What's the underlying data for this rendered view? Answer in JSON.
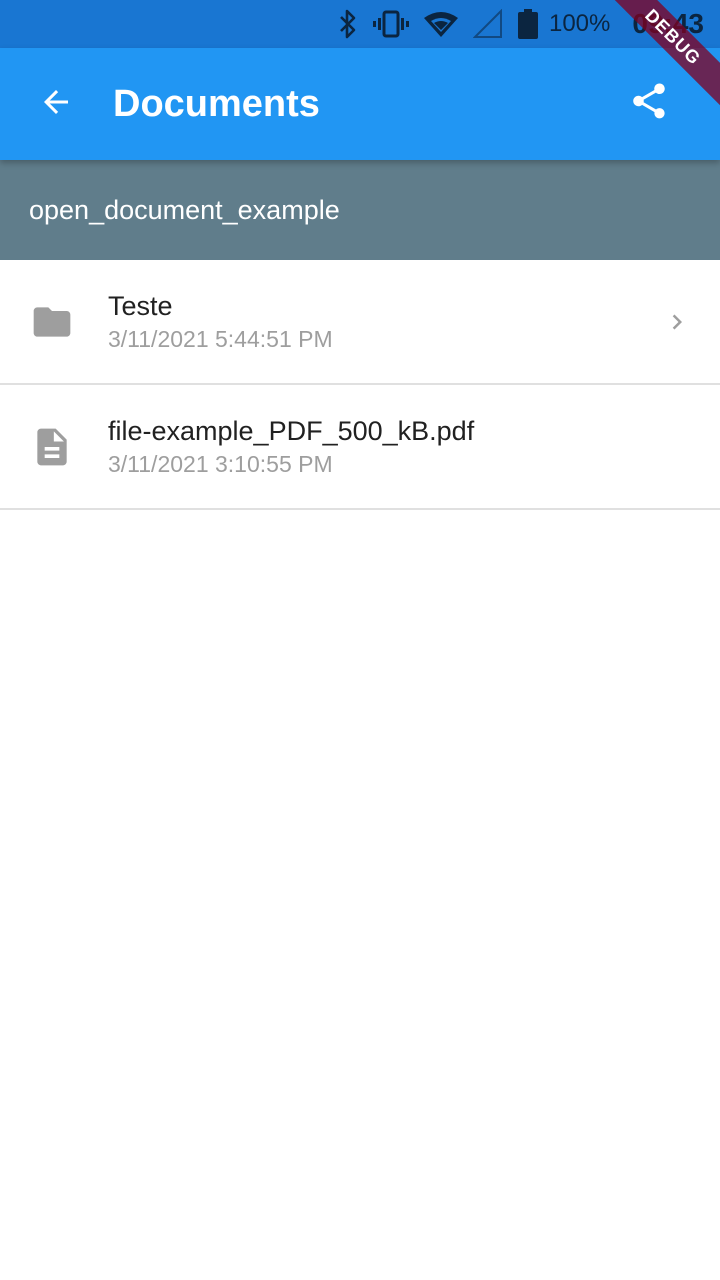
{
  "status_bar": {
    "icons": [
      "bluetooth-icon",
      "vibrate-icon",
      "wifi-icon",
      "cell-signal-icon",
      "battery-icon"
    ],
    "battery_text": "100%",
    "time": "09:43"
  },
  "app_bar": {
    "title": "Documents",
    "back_icon": "arrow-back-icon",
    "share_icon": "share-icon"
  },
  "path_bar": {
    "path": "open_document_example"
  },
  "items": [
    {
      "name": "Teste",
      "date": "3/11/2021 5:44:51 PM",
      "icon": "folder-icon",
      "has_chevron": true
    },
    {
      "name": "file-example_PDF_500_kB.pdf",
      "date": "3/11/2021 3:10:55 PM",
      "icon": "document-icon",
      "has_chevron": false
    }
  ],
  "debug_banner": "DEBUG",
  "colors": {
    "status_bar": "#1976d2",
    "app_bar": "#2196f3",
    "path_bar": "#607d8b",
    "icon_gray": "#9e9e9e"
  }
}
